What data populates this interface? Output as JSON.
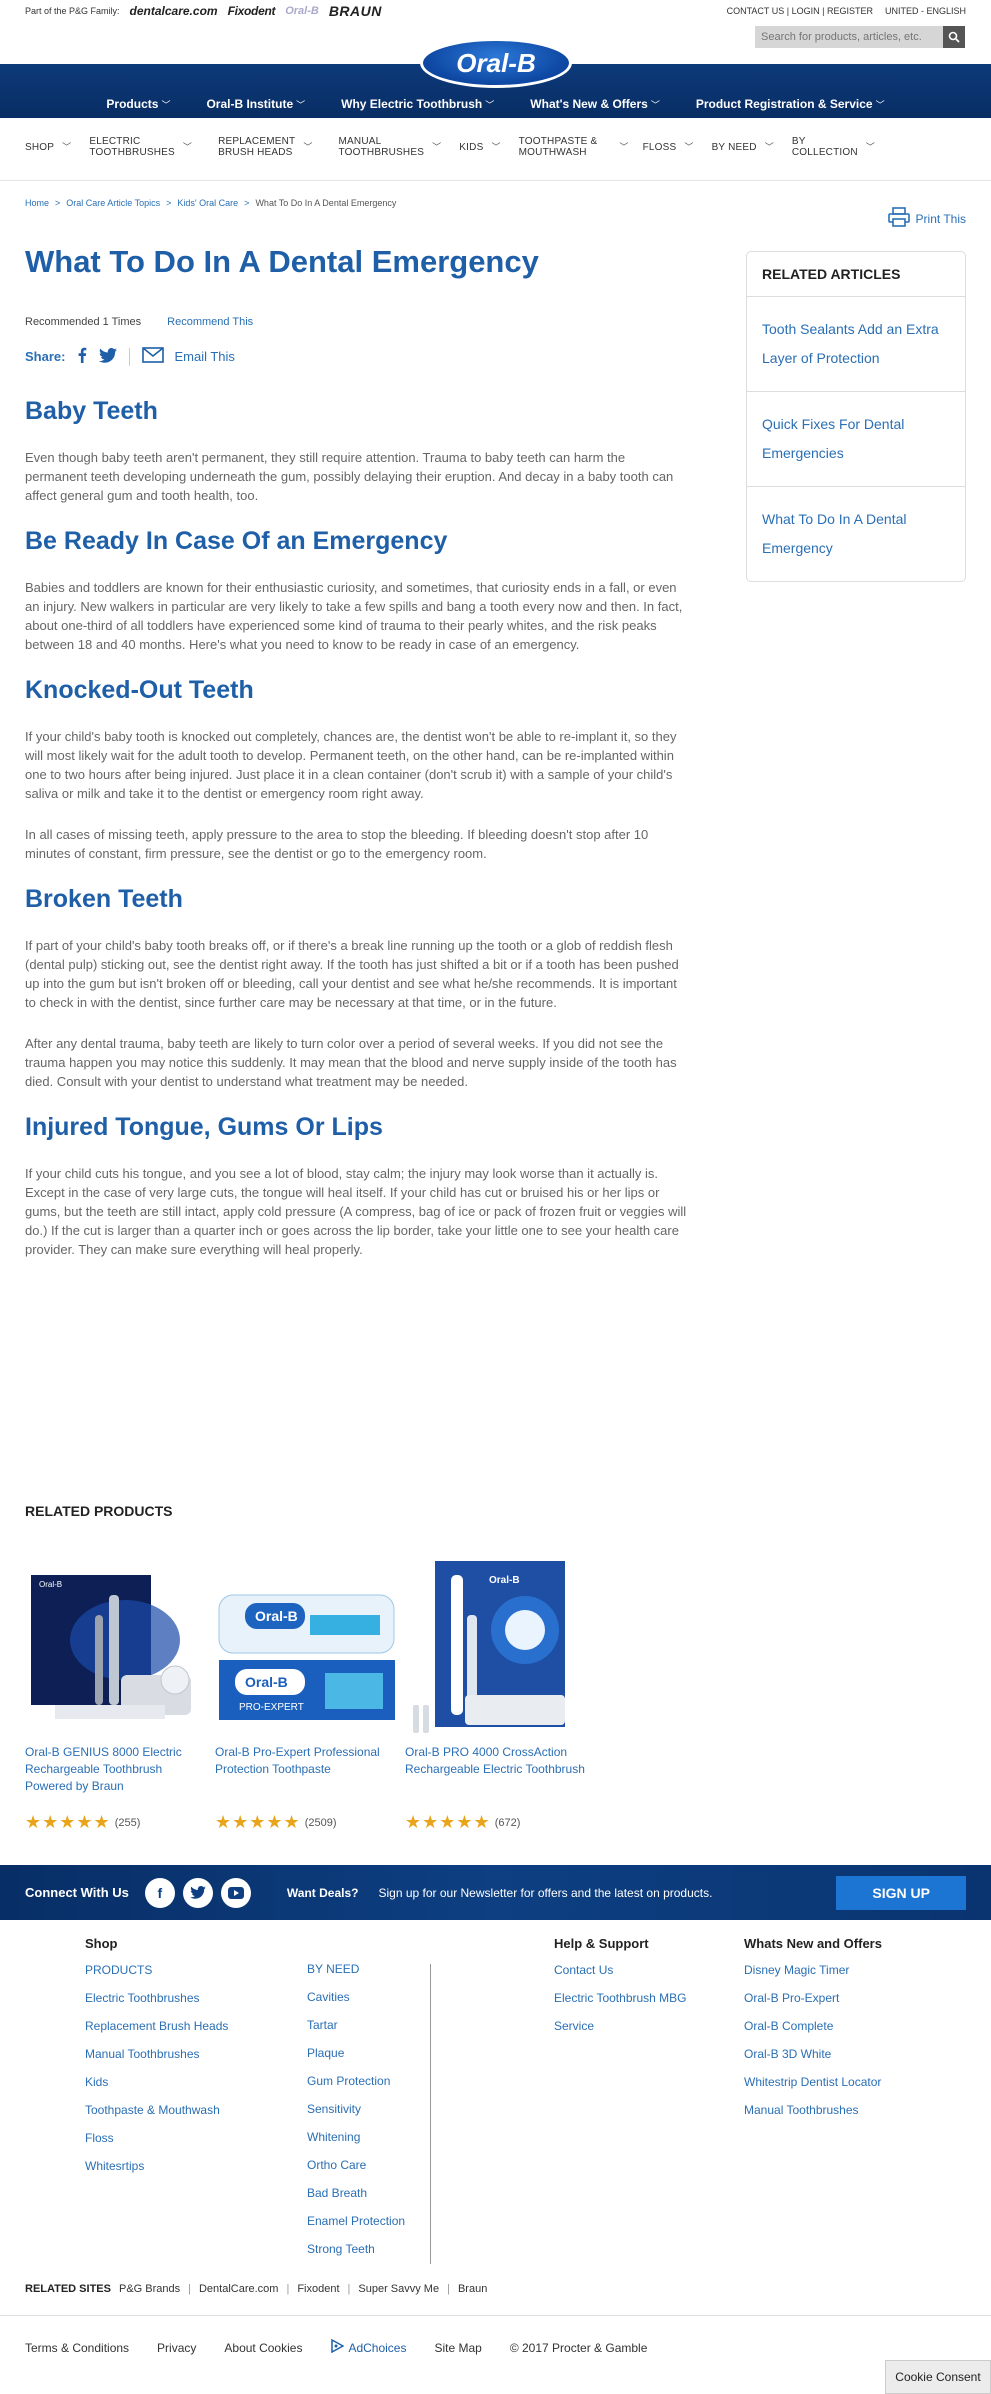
{
  "topbar": {
    "pg_text": "Part of the P&G Family:",
    "brands": [
      "dentalcare.com",
      "Fixodent",
      "Oral-B",
      "BRAUN"
    ],
    "contact": "CONTACT US",
    "login": "LOGIN",
    "register": "REGISTER",
    "locale": "UNITED - ENGLISH"
  },
  "search": {
    "placeholder": "Search for products, articles, etc."
  },
  "logo": "Oral-B",
  "main_nav": [
    "Products",
    "Oral-B Institute",
    "Why Electric Toothbrush",
    "What's New & Offers",
    "Product Registration & Service"
  ],
  "sub_nav": [
    [
      "SHOP"
    ],
    [
      "ELECTRIC",
      "TOOTHBRUSHES"
    ],
    [
      "REPLACEMENT",
      "BRUSH HEADS"
    ],
    [
      "MANUAL",
      "TOOTHBRUSHES"
    ],
    [
      "KIDS"
    ],
    [
      "TOOTHPASTE &",
      "MOUTHWASH"
    ],
    [
      "FLOSS"
    ],
    [
      "BY NEED"
    ],
    [
      "BY",
      "COLLECTION"
    ]
  ],
  "breadcrumb": [
    "Home",
    "Oral Care Article Topics",
    "Kids' Oral Care",
    "What To Do In A Dental Emergency"
  ],
  "print_label": "Print This",
  "title": "What To Do In A Dental Emergency",
  "recommended_text": "Recommended 1 Times",
  "recommend_link": "Recommend This",
  "share_label": "Share:",
  "email_label": "Email This",
  "sections": [
    {
      "heading": "Baby Teeth",
      "paragraphs": [
        "Even though baby teeth aren't permanent, they still require attention. Trauma to baby teeth can harm the permanent teeth developing underneath the gum, possibly delaying their eruption. And decay in a baby tooth can affect general gum and tooth health, too."
      ]
    },
    {
      "heading": "Be Ready In Case Of an Emergency",
      "paragraphs": [
        "Babies and toddlers are known for their enthusiastic curiosity, and sometimes, that curiosity ends in a fall, or even an injury. New walkers in particular are very likely to take a few spills and bang a tooth every now and then. In fact, about one-third of all toddlers have experienced some kind of trauma to their pearly whites, and the risk peaks between 18 and 40 months. Here's what you need to know to be ready in case of an emergency."
      ]
    },
    {
      "heading": "Knocked-Out Teeth",
      "paragraphs": [
        "If your child's baby tooth is knocked out completely, chances are, the dentist won't be able to re-implant it, so they will most likely wait for the adult tooth to develop. Permanent teeth, on the other hand, can be re-implanted within one to two hours after being injured. Just place it in a clean container (don't scrub it) with a sample of your child's saliva or milk and take it to the dentist or emergency room right away.",
        "In all cases of missing teeth, apply pressure to the area to stop the bleeding. If bleeding doesn't stop after 10 minutes of constant, firm pressure, see the dentist or go to the emergency room."
      ]
    },
    {
      "heading": "Broken Teeth",
      "paragraphs": [
        "If part of your child's baby tooth breaks off, or if there's a break line running up the tooth or a glob of reddish flesh (dental pulp) sticking out, see the dentist right away. If the tooth has just shifted a bit or if a tooth has been pushed up into the gum but isn't broken off or bleeding, call your dentist and see what he/she recommends. It is important to check in with the dentist, since further care may be necessary at that time, or in the future.",
        "After any dental trauma, baby teeth are likely to turn color over a period of several weeks. If you did not see the trauma happen you may notice this suddenly. It may mean that the blood and nerve supply inside of the tooth has died. Consult with your dentist to understand what treatment may be needed."
      ]
    },
    {
      "heading": "Injured Tongue, Gums Or Lips",
      "paragraphs": [
        "If your child cuts his tongue, and you see a lot of blood, stay calm; the injury may look worse than it actually is. Except in the case of very large cuts, the tongue will heal itself. If your child has cut or bruised his or her lips or gums, but the teeth are still intact, apply cold pressure (A compress, bag of ice or pack of frozen fruit or veggies will do.) If the cut is larger than a quarter inch or goes across the lip border, take your little one to see your health care provider. They can make sure everything will heal properly."
      ]
    }
  ],
  "related_articles": {
    "heading": "RELATED ARTICLES",
    "items": [
      "Tooth Sealants Add an Extra Layer of Protection",
      "Quick Fixes For Dental Emergencies",
      "What To Do In A Dental Emergency"
    ]
  },
  "related_products": {
    "heading": "RELATED PRODUCTS",
    "items": [
      {
        "name": "Oral-B GENIUS 8000 Electric Rechargeable Toothbrush Powered by Braun",
        "stars": "★★★★★",
        "count": "(255)"
      },
      {
        "name": "Oral-B Pro-Expert Professional Protection Toothpaste",
        "stars": "★★★★★",
        "count": "(2509)"
      },
      {
        "name": "Oral-B PRO 4000 CrossAction Rechargeable Electric Toothbrush",
        "stars": "★★★★★",
        "count": "(672)"
      }
    ]
  },
  "connect": {
    "label": "Connect With Us",
    "deals": "Want Deals?",
    "signup_text": "Sign up for our Newsletter for offers and the latest on products.",
    "signup_button": "SIGN UP"
  },
  "footer": {
    "shop": {
      "heading": "Shop",
      "col1": [
        "PRODUCTS",
        "Electric Toothbrushes",
        "Replacement Brush Heads",
        "Manual Toothbrushes",
        "Kids",
        "Toothpaste & Mouthwash",
        "Floss",
        "Whitesrtips"
      ],
      "col2": [
        "BY NEED",
        "Cavities",
        "Tartar",
        "Plaque",
        "Gum Protection",
        "Sensitivity",
        "Whitening",
        "Ortho Care",
        "Bad Breath",
        "Enamel Protection",
        "Strong Teeth"
      ]
    },
    "help": {
      "heading": "Help & Support",
      "items": [
        "Contact Us",
        "Electric Toothbrush MBG",
        "Service"
      ]
    },
    "whats_new": {
      "heading": "Whats New and Offers",
      "items": [
        "Disney Magic Timer",
        "Oral-B Pro-Expert",
        "Oral-B Complete",
        "Oral-B 3D White",
        "Whitestrip Dentist Locator",
        "Manual Toothbrushes"
      ]
    }
  },
  "related_sites": {
    "label": "RELATED SITES",
    "items": [
      "P&G Brands",
      "DentalCare.com",
      "Fixodent",
      "Super Savvy Me",
      "Braun"
    ]
  },
  "bottom_links": [
    "Terms & Conditions",
    "Privacy",
    "About Cookies",
    "AdChoices",
    "Site Map",
    "© 2017 Procter & Gamble"
  ],
  "cookie_consent": "Cookie Consent",
  "colors": {
    "brand_blue": "#1e5fa8",
    "link_blue": "#2a6fb5",
    "nav_dark": "#0d3a7a",
    "star": "#e8a51c"
  }
}
